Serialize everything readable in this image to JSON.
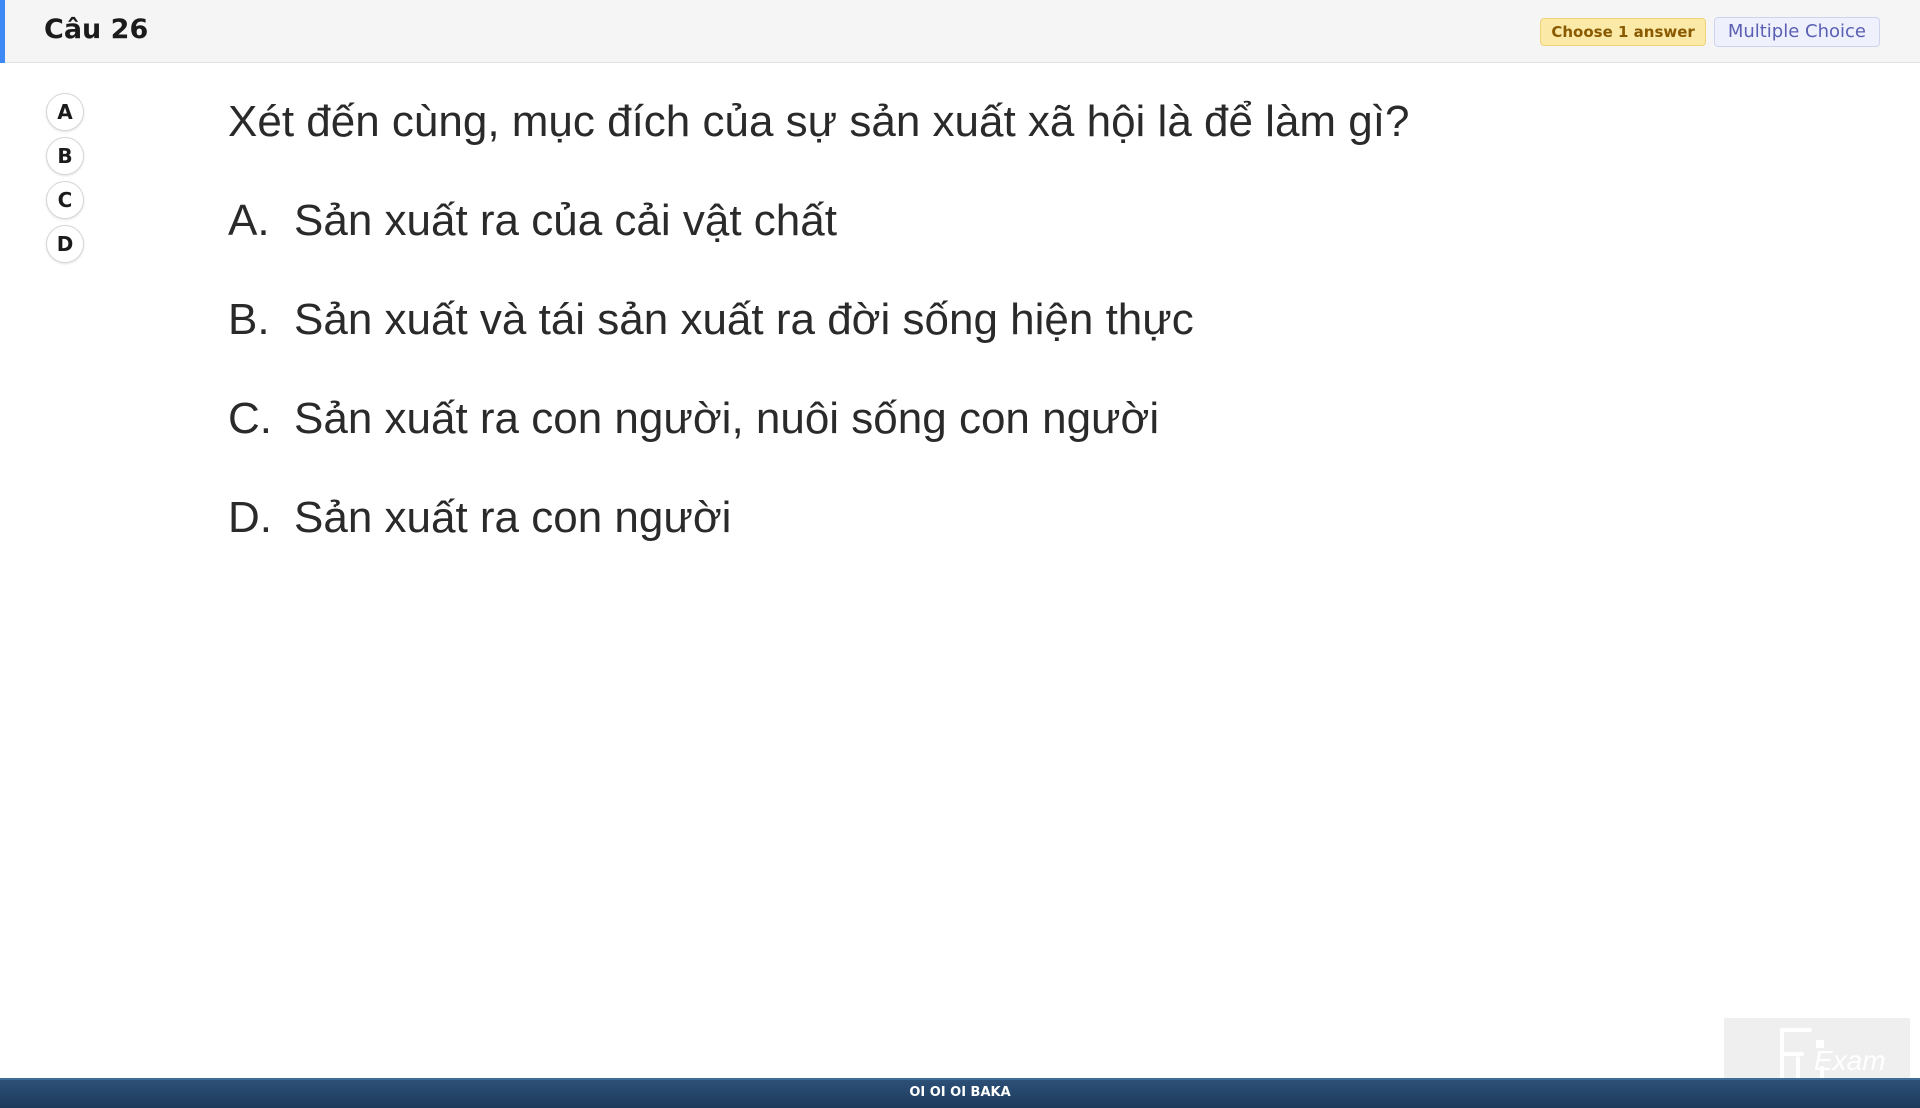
{
  "header": {
    "question_title": "Câu 26",
    "choose_badge": "Choose 1 answer",
    "type_badge": "Multiple Choice",
    "accent_color": "#3d8af7"
  },
  "answer_picker": {
    "options": [
      "A",
      "B",
      "C",
      "D"
    ]
  },
  "question": {
    "text": "Xét đến cùng, mục đích của sự sản xuất xã hội là để làm gì?",
    "choices": [
      {
        "letter": "A.",
        "text": "Sản xuất ra của cải vật chất"
      },
      {
        "letter": "B.",
        "text": "Sản xuất và tái sản xuất ra đời sống hiện thực"
      },
      {
        "letter": "C.",
        "text": "Sản xuất ra con người, nuôi sống con người"
      },
      {
        "letter": "D.",
        "text": "Sản xuất ra con người"
      }
    ]
  },
  "watermark": {
    "logo_text": "FU Exam",
    "icon": "fu-exam-logo"
  },
  "footer": {
    "text": "OI OI OI BAKA"
  }
}
